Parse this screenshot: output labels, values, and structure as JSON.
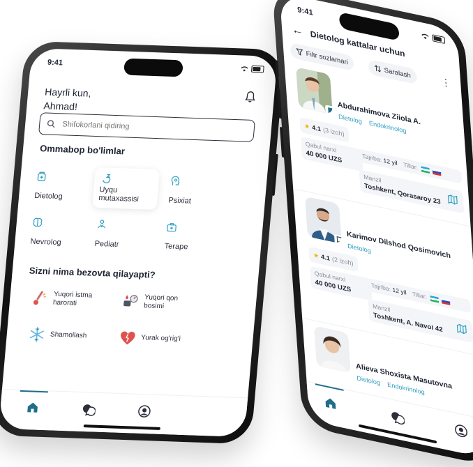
{
  "left_phone": {
    "status_time": "9:41",
    "greeting_line1": "Hayrli kun,",
    "greeting_line2": "Ahmad!",
    "search_placeholder": "Shifokorlani qidiring",
    "departments_title": "Ommabop bo'limlar",
    "departments": [
      {
        "label": "Dietolog",
        "icon": "flask-icon"
      },
      {
        "label": "Uyqu mutaxassisi",
        "icon": "sleep-icon"
      },
      {
        "label": "Psixiat",
        "icon": "brain-head-icon"
      },
      {
        "label": "Nevrolog",
        "icon": "brain-icon"
      },
      {
        "label": "Pediatr",
        "icon": "child-icon"
      },
      {
        "label": "Terape",
        "icon": "medkit-icon"
      }
    ],
    "symptoms_title": "Sizni nima bezovta qilayapti?",
    "symptoms": [
      {
        "label": "Yuqori istma harorati",
        "icon": "thermometer-icon"
      },
      {
        "label": "Yuqori qon bosimi",
        "icon": "blood-pressure-icon"
      },
      {
        "label": "Shamollash",
        "icon": "snowflake-icon"
      },
      {
        "label": "Yurak og'rig'i",
        "icon": "heart-pain-icon"
      }
    ],
    "tabs": [
      "home-icon",
      "chat-icon",
      "profile-icon"
    ],
    "accent": "#1f6f8b"
  },
  "right_phone": {
    "status_time": "9:41",
    "title": "Dietolog kattalar uchun",
    "filter_label": "Filtr sozlamari",
    "sort_label": "Saralash",
    "doctors": [
      {
        "name": "Abdurahimova Ziiola A.",
        "tags": [
          "Dietolog",
          "Endokrinolog"
        ],
        "rating": "4.1",
        "reviews": "(3 izoh)",
        "price_label": "Qabul narxi",
        "price": "40 000 UZS",
        "experience_label": "Tajriba:",
        "experience": "12 yil",
        "languages_label": "Tillar:",
        "address_label": "Manzil",
        "address": "Toshkent, Qorasaroy 23"
      },
      {
        "name": "Karimov Dilshod Qosimovich",
        "tags": [
          "Dietolog"
        ],
        "rating": "4.1",
        "reviews": "(2 izoh)",
        "price_label": "Qabul narxi",
        "price": "40 000 UZS",
        "experience_label": "Tajriba:",
        "experience": "12 yil",
        "languages_label": "Tillar:",
        "address_label": "Manzil",
        "address": "Toshkent, A. Navoi 42"
      },
      {
        "name": "Alieva Shoxista Masutovna",
        "tags": [
          "Dietolog",
          "Endokrinolog"
        ]
      }
    ],
    "accent": "#2f9fc2"
  }
}
